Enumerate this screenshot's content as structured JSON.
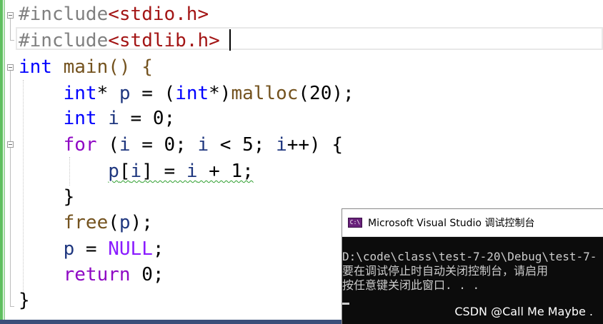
{
  "editor": {
    "lines": [
      {
        "t1": "#include",
        "t2": "<stdio.h>"
      },
      {
        "t1": "#include",
        "t2": "<stdlib.h>"
      },
      {
        "kw": "int",
        "rest": " main() {"
      },
      {
        "indent": "    ",
        "kw": "int",
        "rest1": "* ",
        "var1": "p",
        "rest2": " = (",
        "kw2": "int",
        "rest3": "*)",
        "fn": "malloc",
        "rest4": "(20);"
      },
      {
        "indent": "    ",
        "kw": "int",
        "rest1": " ",
        "var1": "i",
        "rest2": " = 0;"
      },
      {
        "indent": "    ",
        "ctl": "for",
        "rest1": " (",
        "v1": "i",
        "r2": " = 0; ",
        "v2": "i",
        "r3": " < 5; ",
        "v3": "i",
        "r4": "++) {"
      },
      {
        "indent": "        ",
        "v1": "p",
        "r1": "[",
        "v2": "i",
        "r2": "] = ",
        "v3": "i",
        "r3": " + 1;"
      },
      {
        "indent": "    ",
        "r1": "}"
      },
      {
        "indent": "    ",
        "fn": "free",
        "r1": "(",
        "v1": "p",
        "r2": ");"
      },
      {
        "indent": "    ",
        "v1": "p",
        "r1": " = ",
        "mac": "NULL",
        "r2": ";"
      },
      {
        "indent": "    ",
        "ctl": "return",
        "r1": " 0;"
      },
      {
        "r1": "}"
      }
    ]
  },
  "console": {
    "title": "Microsoft Visual Studio 调试控制台",
    "icon": "vs-console-icon",
    "lines": [
      "D:\\code\\class\\test-7-20\\Debug\\test-7-",
      "要在调试停止时自动关闭控制台，请启用",
      "按任意键关闭此窗口. . ."
    ]
  },
  "watermark": "CSDN @Call Me Maybe .",
  "colors": {
    "keyword": "#0000ff",
    "control": "#8f08c4",
    "function": "#74531f",
    "variable": "#1f377f",
    "string": "#a31515",
    "preprocessor": "#808080",
    "macro": "#8a1bff",
    "console_bg": "#0c0c0c"
  }
}
